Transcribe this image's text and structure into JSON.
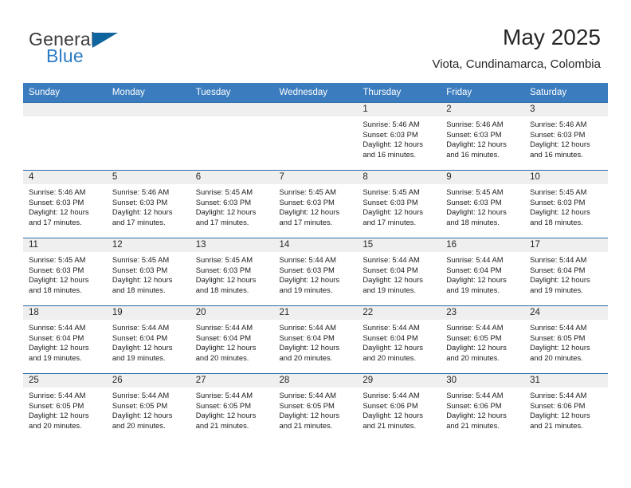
{
  "brand": {
    "name_part1": "General",
    "name_part2": "Blue",
    "triangle_color": "#10659f",
    "blue_color": "#2b7cc4"
  },
  "header": {
    "title": "May 2025",
    "subtitle": "Viota, Cundinamarca, Colombia"
  },
  "theme": {
    "header_row_bg": "#3a7cbe",
    "daynum_band_bg": "#efefef",
    "row_border": "#2c6ca8"
  },
  "weekday_headers": [
    "Sunday",
    "Monday",
    "Tuesday",
    "Wednesday",
    "Thursday",
    "Friday",
    "Saturday"
  ],
  "weeks": [
    [
      {
        "day": "",
        "lines": []
      },
      {
        "day": "",
        "lines": []
      },
      {
        "day": "",
        "lines": []
      },
      {
        "day": "",
        "lines": []
      },
      {
        "day": "1",
        "lines": [
          "Sunrise: 5:46 AM",
          "Sunset: 6:03 PM",
          "Daylight: 12 hours",
          "and 16 minutes."
        ]
      },
      {
        "day": "2",
        "lines": [
          "Sunrise: 5:46 AM",
          "Sunset: 6:03 PM",
          "Daylight: 12 hours",
          "and 16 minutes."
        ]
      },
      {
        "day": "3",
        "lines": [
          "Sunrise: 5:46 AM",
          "Sunset: 6:03 PM",
          "Daylight: 12 hours",
          "and 16 minutes."
        ]
      }
    ],
    [
      {
        "day": "4",
        "lines": [
          "Sunrise: 5:46 AM",
          "Sunset: 6:03 PM",
          "Daylight: 12 hours",
          "and 17 minutes."
        ]
      },
      {
        "day": "5",
        "lines": [
          "Sunrise: 5:46 AM",
          "Sunset: 6:03 PM",
          "Daylight: 12 hours",
          "and 17 minutes."
        ]
      },
      {
        "day": "6",
        "lines": [
          "Sunrise: 5:45 AM",
          "Sunset: 6:03 PM",
          "Daylight: 12 hours",
          "and 17 minutes."
        ]
      },
      {
        "day": "7",
        "lines": [
          "Sunrise: 5:45 AM",
          "Sunset: 6:03 PM",
          "Daylight: 12 hours",
          "and 17 minutes."
        ]
      },
      {
        "day": "8",
        "lines": [
          "Sunrise: 5:45 AM",
          "Sunset: 6:03 PM",
          "Daylight: 12 hours",
          "and 17 minutes."
        ]
      },
      {
        "day": "9",
        "lines": [
          "Sunrise: 5:45 AM",
          "Sunset: 6:03 PM",
          "Daylight: 12 hours",
          "and 18 minutes."
        ]
      },
      {
        "day": "10",
        "lines": [
          "Sunrise: 5:45 AM",
          "Sunset: 6:03 PM",
          "Daylight: 12 hours",
          "and 18 minutes."
        ]
      }
    ],
    [
      {
        "day": "11",
        "lines": [
          "Sunrise: 5:45 AM",
          "Sunset: 6:03 PM",
          "Daylight: 12 hours",
          "and 18 minutes."
        ]
      },
      {
        "day": "12",
        "lines": [
          "Sunrise: 5:45 AM",
          "Sunset: 6:03 PM",
          "Daylight: 12 hours",
          "and 18 minutes."
        ]
      },
      {
        "day": "13",
        "lines": [
          "Sunrise: 5:45 AM",
          "Sunset: 6:03 PM",
          "Daylight: 12 hours",
          "and 18 minutes."
        ]
      },
      {
        "day": "14",
        "lines": [
          "Sunrise: 5:44 AM",
          "Sunset: 6:03 PM",
          "Daylight: 12 hours",
          "and 19 minutes."
        ]
      },
      {
        "day": "15",
        "lines": [
          "Sunrise: 5:44 AM",
          "Sunset: 6:04 PM",
          "Daylight: 12 hours",
          "and 19 minutes."
        ]
      },
      {
        "day": "16",
        "lines": [
          "Sunrise: 5:44 AM",
          "Sunset: 6:04 PM",
          "Daylight: 12 hours",
          "and 19 minutes."
        ]
      },
      {
        "day": "17",
        "lines": [
          "Sunrise: 5:44 AM",
          "Sunset: 6:04 PM",
          "Daylight: 12 hours",
          "and 19 minutes."
        ]
      }
    ],
    [
      {
        "day": "18",
        "lines": [
          "Sunrise: 5:44 AM",
          "Sunset: 6:04 PM",
          "Daylight: 12 hours",
          "and 19 minutes."
        ]
      },
      {
        "day": "19",
        "lines": [
          "Sunrise: 5:44 AM",
          "Sunset: 6:04 PM",
          "Daylight: 12 hours",
          "and 19 minutes."
        ]
      },
      {
        "day": "20",
        "lines": [
          "Sunrise: 5:44 AM",
          "Sunset: 6:04 PM",
          "Daylight: 12 hours",
          "and 20 minutes."
        ]
      },
      {
        "day": "21",
        "lines": [
          "Sunrise: 5:44 AM",
          "Sunset: 6:04 PM",
          "Daylight: 12 hours",
          "and 20 minutes."
        ]
      },
      {
        "day": "22",
        "lines": [
          "Sunrise: 5:44 AM",
          "Sunset: 6:04 PM",
          "Daylight: 12 hours",
          "and 20 minutes."
        ]
      },
      {
        "day": "23",
        "lines": [
          "Sunrise: 5:44 AM",
          "Sunset: 6:05 PM",
          "Daylight: 12 hours",
          "and 20 minutes."
        ]
      },
      {
        "day": "24",
        "lines": [
          "Sunrise: 5:44 AM",
          "Sunset: 6:05 PM",
          "Daylight: 12 hours",
          "and 20 minutes."
        ]
      }
    ],
    [
      {
        "day": "25",
        "lines": [
          "Sunrise: 5:44 AM",
          "Sunset: 6:05 PM",
          "Daylight: 12 hours",
          "and 20 minutes."
        ]
      },
      {
        "day": "26",
        "lines": [
          "Sunrise: 5:44 AM",
          "Sunset: 6:05 PM",
          "Daylight: 12 hours",
          "and 20 minutes."
        ]
      },
      {
        "day": "27",
        "lines": [
          "Sunrise: 5:44 AM",
          "Sunset: 6:05 PM",
          "Daylight: 12 hours",
          "and 21 minutes."
        ]
      },
      {
        "day": "28",
        "lines": [
          "Sunrise: 5:44 AM",
          "Sunset: 6:05 PM",
          "Daylight: 12 hours",
          "and 21 minutes."
        ]
      },
      {
        "day": "29",
        "lines": [
          "Sunrise: 5:44 AM",
          "Sunset: 6:06 PM",
          "Daylight: 12 hours",
          "and 21 minutes."
        ]
      },
      {
        "day": "30",
        "lines": [
          "Sunrise: 5:44 AM",
          "Sunset: 6:06 PM",
          "Daylight: 12 hours",
          "and 21 minutes."
        ]
      },
      {
        "day": "31",
        "lines": [
          "Sunrise: 5:44 AM",
          "Sunset: 6:06 PM",
          "Daylight: 12 hours",
          "and 21 minutes."
        ]
      }
    ]
  ]
}
